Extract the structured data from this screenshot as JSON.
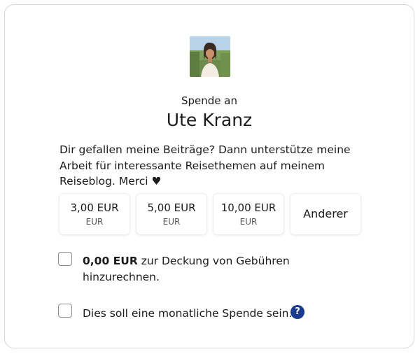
{
  "header": {
    "donate_to_label": "Spende an",
    "recipient_name": "Ute Kranz"
  },
  "description": "Dir gefallen meine Beiträge? Dann unterstütze meine Arbeit für interessante Reisethemen auf meinem Reiseblog. Merci ♥",
  "amounts": [
    {
      "value": "3,00 EUR",
      "currency": "EUR"
    },
    {
      "value": "5,00 EUR",
      "currency": "EUR"
    },
    {
      "value": "10,00 EUR",
      "currency": "EUR"
    }
  ],
  "other_label": "Anderer",
  "fee_option": {
    "checked": false,
    "amount": "0,00 EUR",
    "text": "zur Deckung von Gebühren hinzurechnen."
  },
  "monthly_option": {
    "checked": false,
    "text": "Dies soll eine monatliche Spende sein."
  },
  "help_icon": {
    "icon": "question-mark-icon",
    "glyph": "?"
  },
  "colors": {
    "help_icon_bg": "#1a3a8f",
    "card_border": "#d6d6d6"
  }
}
